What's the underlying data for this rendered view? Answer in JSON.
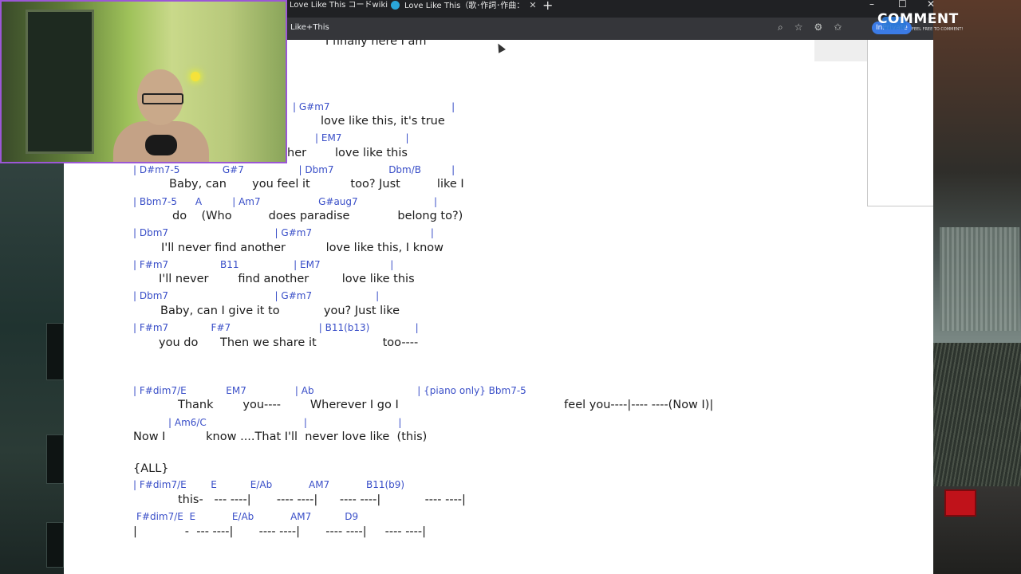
{
  "tabs": [
    {
      "label": "Love Like This コードwiki"
    },
    {
      "label": "Love Like This（歌･作詞･作曲："
    }
  ],
  "address": {
    "url": "Like+This",
    "inprivate": "InPrivate"
  },
  "overlay": {
    "logo": "COMMENT",
    "tagline": "FEEL FREE TO COMMENT!"
  },
  "song": {
    "top_partial": "I finally here I am",
    "lines": [
      {
        "chords": "| G#m7                                        |",
        "lyric": "love like this, it's true"
      },
      {
        "chords": "| EM7                     |",
        "lyric_a": "her",
        "lyric_b": "love like this"
      },
      {
        "chords": "| D#m7-5              G#7                  | Dbm7                  Dbm/B          |",
        "lyric": "Baby, can       you feel it           too? Just          like I"
      },
      {
        "chords": "| Bbm7-5      A          | Am7                   G#aug7                         |",
        "lyric": "do    (Who          does paradise             belong to?)"
      },
      {
        "chords": "| Dbm7                                   | G#m7                                       |",
        "lyric": "I'll never find another           love like this, I know"
      },
      {
        "chords": "| F#m7                 B11                  | EM7                       |",
        "lyric": "I'll never        find another         love like this"
      },
      {
        "chords": "| Dbm7                                   | G#m7                     |",
        "lyric": "Baby, can I give it to            you? Just like"
      },
      {
        "chords": "| F#m7              F#7                             | B11(b13)               |",
        "lyric": "you do      Then we share it                  too----"
      },
      {
        "chords": "| F#dim7/E             EM7                | Ab                                  | {piano only} Bbm7-5",
        "lyric": "Thank        you----        Wherever I go I                                             feel you----|---- ----(Now I)|"
      },
      {
        "chords": "| Am6/C                                |                              |",
        "lyric": "Now I           know ....That I'll  never love like  (this)"
      },
      {
        "section": "{ALL}"
      },
      {
        "chords": "| F#dim7/E        E           E/Ab            AM7            B11(b9)",
        "lyric": "this-   --- ----|       ---- ----|      ---- ----|            ---- ----|"
      },
      {
        "chords": "F#dim7/E  E            E/Ab            AM7           D9",
        "lyric": "|             -  --- ----|       ---- ----|       ---- ----|     ---- ----|"
      }
    ]
  }
}
